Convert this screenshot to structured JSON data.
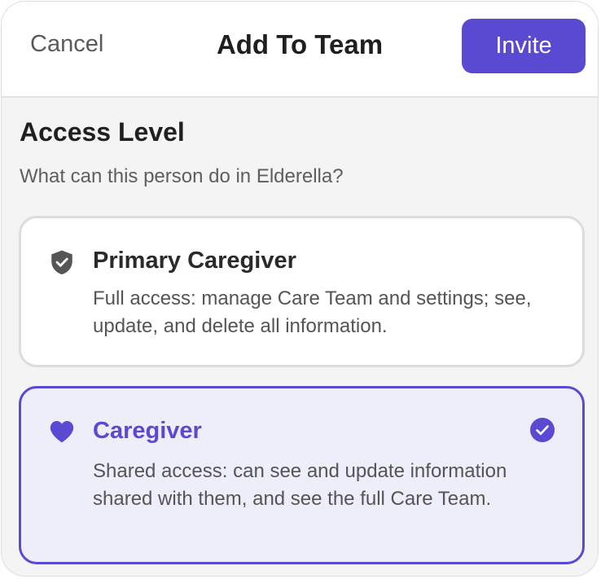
{
  "header": {
    "cancel_label": "Cancel",
    "title": "Add To Team",
    "invite_label": "Invite"
  },
  "section": {
    "heading": "Access Level",
    "subtitle": "What can this person do in Elderella?"
  },
  "options": [
    {
      "icon": "shield-check-icon",
      "title": "Primary Caregiver",
      "description": "Full access: manage Care Team and settings; see, update, and delete all information.",
      "selected": false
    },
    {
      "icon": "heart-icon",
      "title": "Caregiver",
      "description": "Shared access: can see and update information shared with them, and see the full Care Team.",
      "selected": true
    }
  ],
  "colors": {
    "accent": "#5a4ad1",
    "selected_background": "#eeedfa",
    "page_background": "#f4f4f4"
  }
}
